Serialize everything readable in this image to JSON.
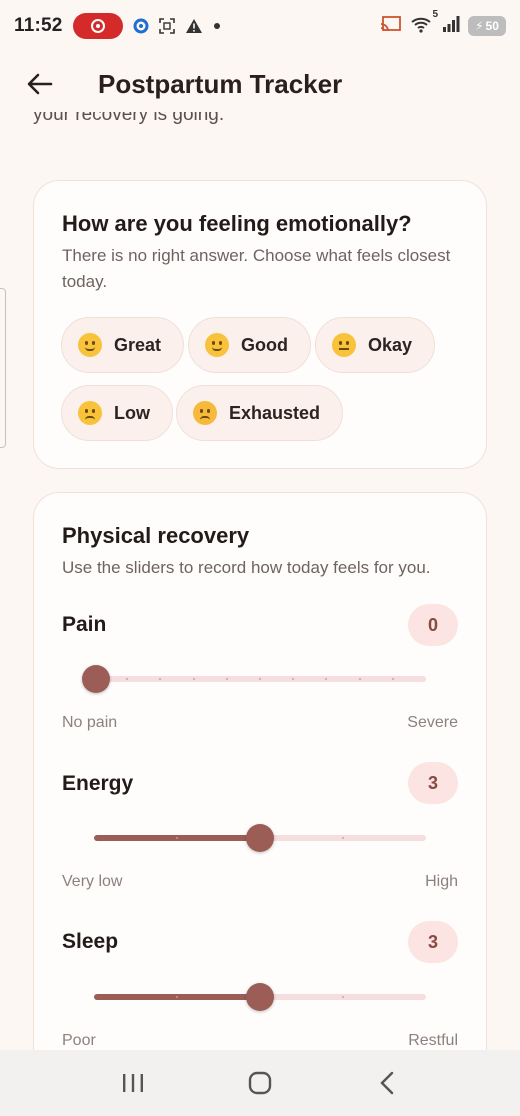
{
  "status_bar": {
    "time": "11:52",
    "battery": "50",
    "signal_superscript": "5"
  },
  "header": {
    "title": "Postpartum Tracker"
  },
  "scrolled_text": "your recovery is going.",
  "emotion_card": {
    "title": "How are you feeling emotionally?",
    "subtitle": "There is no right answer. Choose what feels closest today.",
    "options": [
      {
        "label": "Great",
        "emoji": "grinning-face-icon"
      },
      {
        "label": "Good",
        "emoji": "slightly-smiling-face-icon"
      },
      {
        "label": "Okay",
        "emoji": "neutral-face-icon"
      },
      {
        "label": "Low",
        "emoji": "pensive-face-icon"
      },
      {
        "label": "Exhausted",
        "emoji": "tired-face-icon"
      }
    ]
  },
  "physical_card": {
    "title": "Physical recovery",
    "subtitle": "Use the sliders to record how today feels for you.",
    "sliders": [
      {
        "label": "Pain",
        "value": "0",
        "min_label": "No pain",
        "max_label": "Severe",
        "fraction": 0.0,
        "divisions": 10
      },
      {
        "label": "Energy",
        "value": "3",
        "min_label": "Very low",
        "max_label": "High",
        "fraction": 0.5,
        "divisions": 4
      },
      {
        "label": "Sleep",
        "value": "3",
        "min_label": "Poor",
        "max_label": "Restful",
        "fraction": 0.5,
        "divisions": 4
      }
    ]
  },
  "colors": {
    "accent": "#9b5d55",
    "background": "#fdf7f4",
    "badge": "#fbe4e2"
  }
}
